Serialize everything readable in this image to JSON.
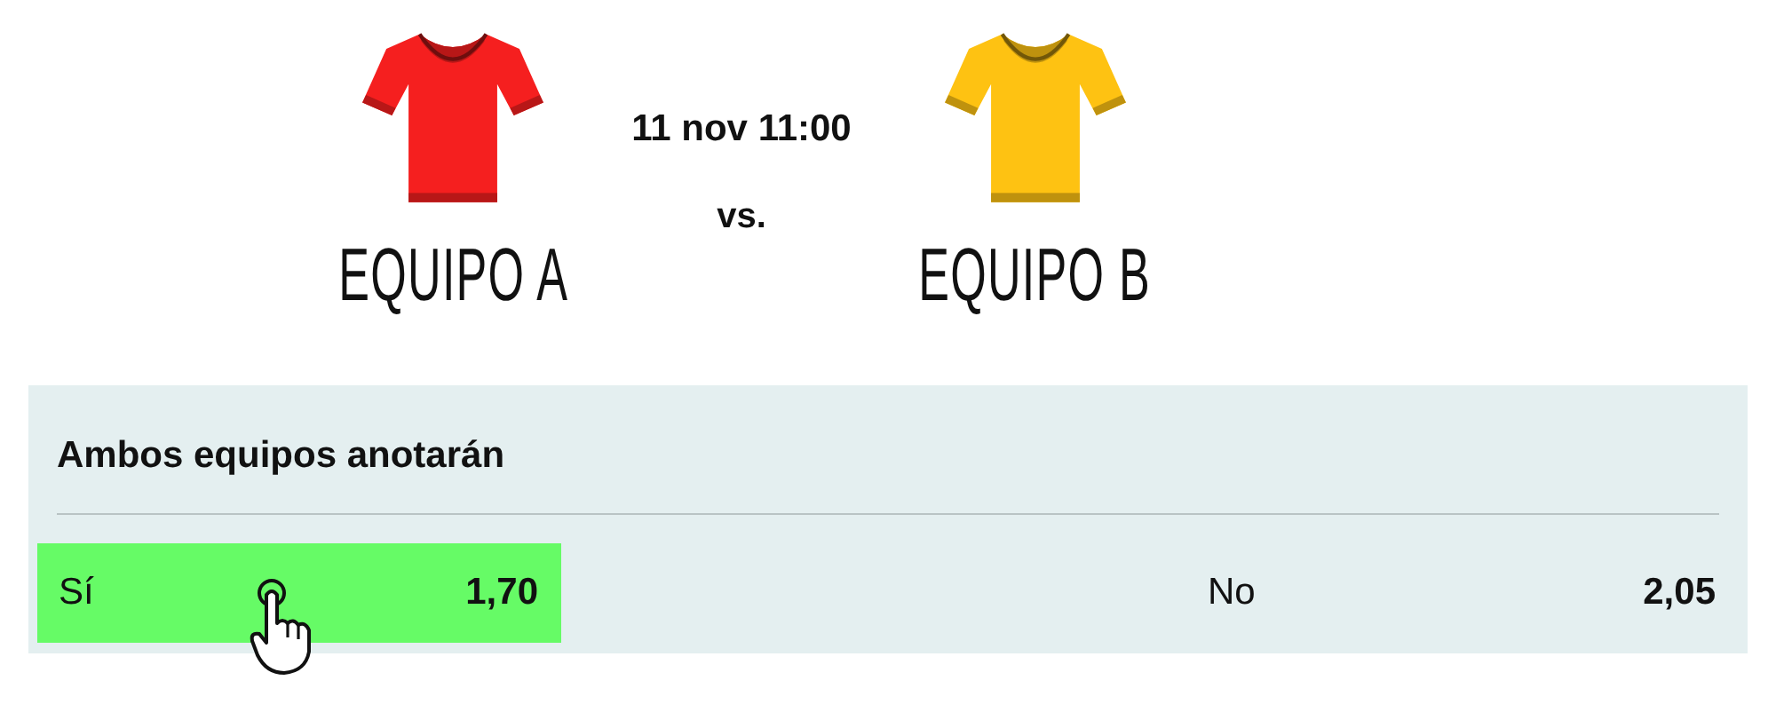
{
  "match": {
    "date": "11 nov 11:00",
    "separator": "vs."
  },
  "teams": [
    {
      "name": "EQUIPO A",
      "color": "#f51f1f"
    },
    {
      "name": "EQUIPO B",
      "color": "#fec212"
    }
  ],
  "market": {
    "title": "Ambos equipos anotarán",
    "options": [
      {
        "label": "Sí",
        "odds": "1,70",
        "selected": true
      },
      {
        "label": "No",
        "odds": "2,05",
        "selected": false
      }
    ]
  }
}
